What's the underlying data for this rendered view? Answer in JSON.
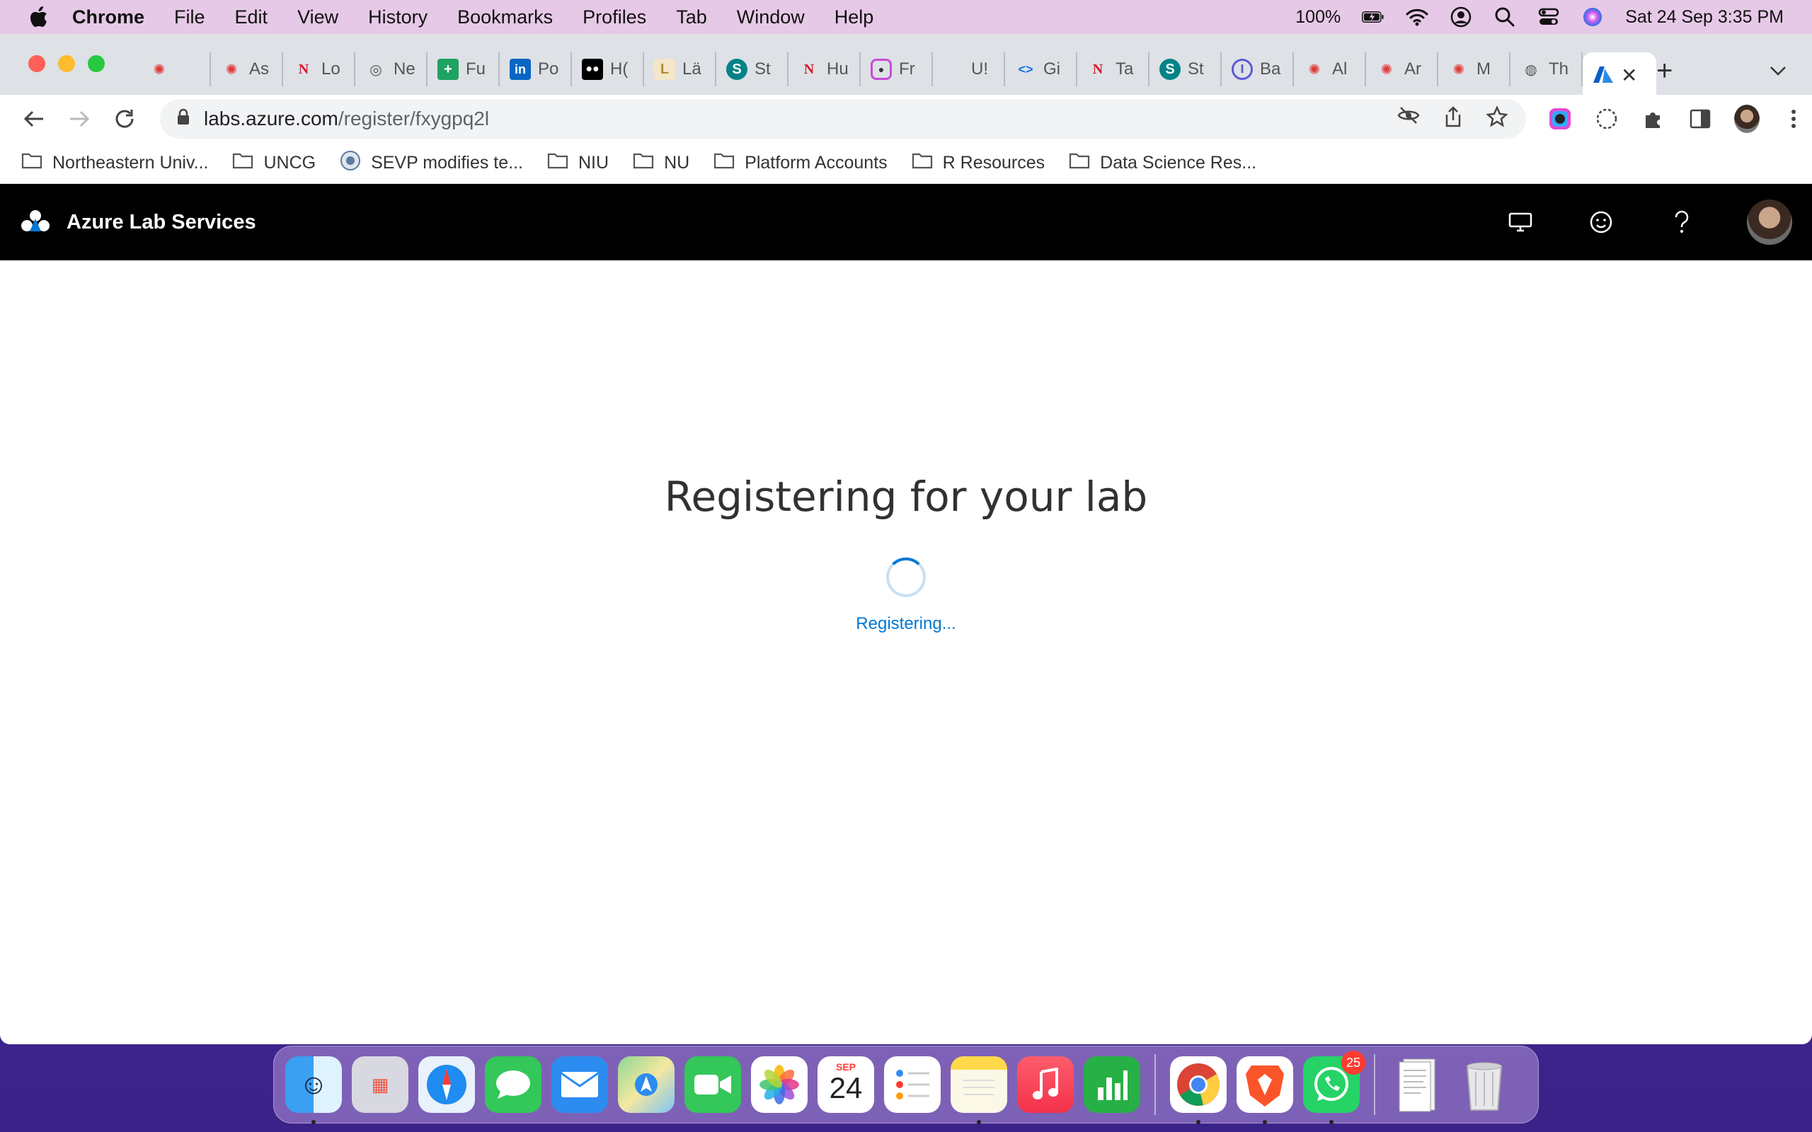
{
  "menubar": {
    "app": "Chrome",
    "items": [
      "File",
      "Edit",
      "View",
      "History",
      "Bookmarks",
      "Profiles",
      "Tab",
      "Window",
      "Help"
    ],
    "battery": "100%",
    "datetime": "Sat 24 Sep  3:35 PM"
  },
  "tabs": [
    {
      "label": ""
    },
    {
      "label": "As"
    },
    {
      "label": "Lo"
    },
    {
      "label": "Ne"
    },
    {
      "label": "Fu"
    },
    {
      "label": "Po"
    },
    {
      "label": "H("
    },
    {
      "label": "Lä"
    },
    {
      "label": "St"
    },
    {
      "label": "Hu"
    },
    {
      "label": "Fr"
    },
    {
      "label": "U!"
    },
    {
      "label": "Gi"
    },
    {
      "label": "Ta"
    },
    {
      "label": "St"
    },
    {
      "label": "Ba"
    },
    {
      "label": "Al"
    },
    {
      "label": "Ar"
    },
    {
      "label": "M"
    },
    {
      "label": "Th"
    }
  ],
  "address": {
    "host": "labs.azure.com",
    "path": "/register/fxygpq2l"
  },
  "bookmarks": [
    {
      "label": "Northeastern Univ..."
    },
    {
      "label": "UNCG"
    },
    {
      "label": "SEVP modifies te..."
    },
    {
      "label": "NIU"
    },
    {
      "label": "NU"
    },
    {
      "label": "Platform Accounts"
    },
    {
      "label": "R Resources"
    },
    {
      "label": "Data Science Res..."
    }
  ],
  "app": {
    "title": "Azure Lab Services"
  },
  "main": {
    "heading": "Registering for your lab",
    "status": "Registering..."
  },
  "dock": {
    "calendar_month": "SEP",
    "calendar_day": "24",
    "whatsapp_badge": "25"
  }
}
